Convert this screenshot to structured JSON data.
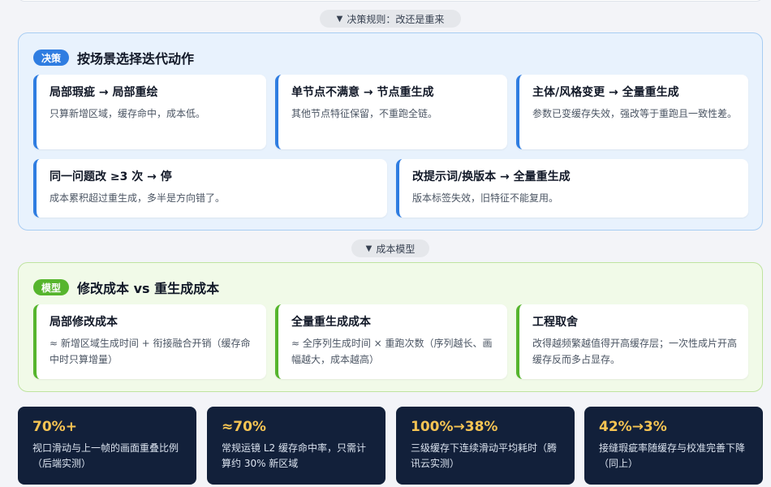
{
  "section_labels": {
    "decision": "决策规则：改还是重来",
    "cost": "成本模型"
  },
  "decision_panel": {
    "badge": "决策",
    "title": "按场景选择迭代动作",
    "cards": [
      {
        "title": "局部瑕疵 → 局部重绘",
        "desc": "只算新增区域，缓存命中，成本低。"
      },
      {
        "title": "单节点不满意 → 节点重生成",
        "desc": "其他节点特征保留，不重跑全链。"
      },
      {
        "title": "主体/风格变更 → 全量重生成",
        "desc": "参数已变缓存失效，强改等于重跑且一致性差。"
      },
      {
        "title": "同一问题改 ≥3 次 → 停",
        "desc": "成本累积超过重生成，多半是方向错了。"
      },
      {
        "title": "改提示词/换版本 → 全量重生成",
        "desc": "版本标签失效，旧特征不能复用。"
      }
    ]
  },
  "cost_panel": {
    "badge": "模型",
    "title": "修改成本 vs 重生成成本",
    "cards": [
      {
        "title": "局部修改成本",
        "desc": "≈ 新增区域生成时间 + 衔接融合开销（缓存命中时只算增量）"
      },
      {
        "title": "全量重生成成本",
        "desc": "≈ 全序列生成时间 × 重跑次数（序列越长、画幅越大，成本越高）"
      },
      {
        "title": "工程取舍",
        "desc": "改得越频繁越值得开高缓存层；一次性成片开高缓存反而多占显存。"
      }
    ]
  },
  "stats": [
    {
      "value": "70%+",
      "label": "视口滑动与上一帧的画面重叠比例（后端实测）"
    },
    {
      "value": "≈70%",
      "label": "常规运镜 L2 缓存命中率，只需计算约 30% 新区域"
    },
    {
      "value": "100%→38%",
      "label": "三级缓存下连续滑动平均耗时（腾讯云实测）"
    },
    {
      "value": "42%→3%",
      "label": "接缝瑕疵率随缓存与校准完善下降（同上）"
    }
  ],
  "icons": {
    "toggle": "triangle-down-icon"
  },
  "colors": {
    "decision_accent": "#2f7de1",
    "cost_accent": "#56b52d",
    "stat_background": "#12203a",
    "stat_value": "#f6c453"
  }
}
